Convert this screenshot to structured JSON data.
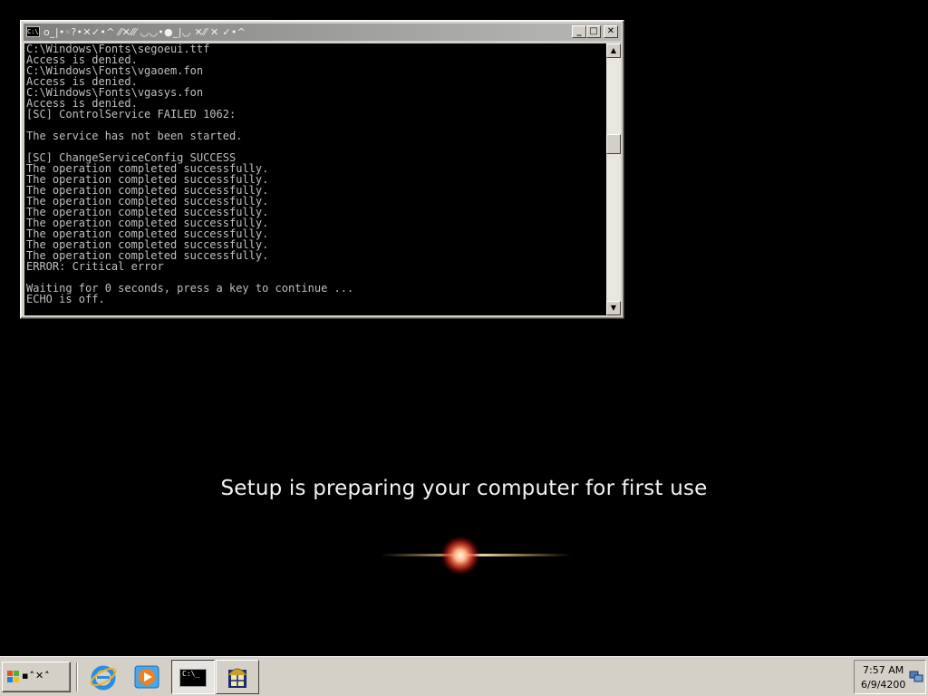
{
  "console": {
    "title_glyphs": "o_|•◦?•✕✓•^ ⁄⁄✕⁄⁄⁄ ◡◡•●_|◡ ✕⁄⁄ ✕ ✓•^",
    "icon_text": "C:\\",
    "buttons": {
      "minimize": "_",
      "maximize": "□",
      "close": "✕"
    },
    "lines": [
      "C:\\Windows\\Fonts\\segoeui.ttf",
      "Access is denied.",
      "C:\\Windows\\Fonts\\vgaoem.fon",
      "Access is denied.",
      "C:\\Windows\\Fonts\\vgasys.fon",
      "Access is denied.",
      "[SC] ControlService FAILED 1062:",
      "",
      "The service has not been started.",
      "",
      "[SC] ChangeServiceConfig SUCCESS",
      "The operation completed successfully.",
      "The operation completed successfully.",
      "The operation completed successfully.",
      "The operation completed successfully.",
      "The operation completed successfully.",
      "The operation completed successfully.",
      "The operation completed successfully.",
      "The operation completed successfully.",
      "The operation completed successfully.",
      "ERROR: Critical error",
      "",
      "Waiting for 0 seconds, press a key to continue ...",
      "ECHO is off."
    ],
    "scroll_up": "▲",
    "scroll_down": "▼"
  },
  "setup": {
    "message": "Setup is preparing your computer for first use"
  },
  "taskbar": {
    "start_glyphs": "▪˄✕˄",
    "quick_launch": [
      "internet-explorer-icon",
      "media-player-icon"
    ],
    "tasks": [
      {
        "name": "cmd",
        "label": "C:\\_"
      },
      {
        "name": "setup",
        "icon": "setup-window-icon"
      }
    ],
    "clock": {
      "time": "7:57 AM",
      "date": "6/9/4200"
    }
  },
  "colors": {
    "desktop": "#000000",
    "console_bg": "#000000",
    "console_text": "#c0c0c0",
    "chrome": "#d4d0c8",
    "setup_text": "#f2f2f2"
  }
}
